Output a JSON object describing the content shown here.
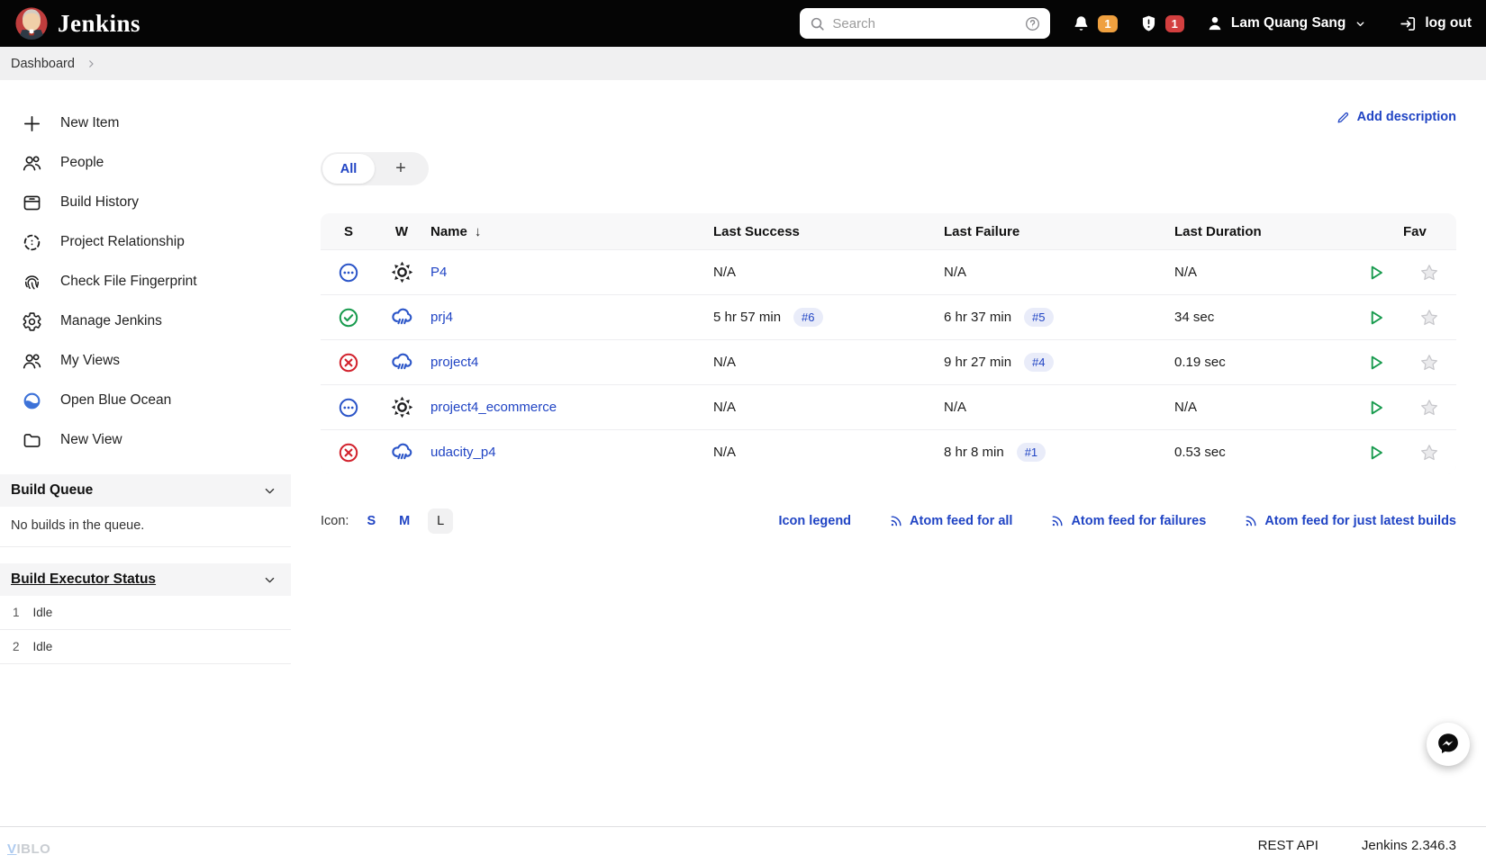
{
  "topbar": {
    "brand": "Jenkins",
    "search_placeholder": "Search",
    "notification_count": "1",
    "security_count": "1",
    "user_name": "Lam Quang Sang",
    "logout_label": "log out"
  },
  "breadcrumb": {
    "items": [
      "Dashboard"
    ]
  },
  "sidebar": {
    "items": [
      {
        "label": "New Item",
        "icon": "plus"
      },
      {
        "label": "People",
        "icon": "people"
      },
      {
        "label": "Build History",
        "icon": "history"
      },
      {
        "label": "Project Relationship",
        "icon": "relationship"
      },
      {
        "label": "Check File Fingerprint",
        "icon": "fingerprint"
      },
      {
        "label": "Manage Jenkins",
        "icon": "gear"
      },
      {
        "label": "My Views",
        "icon": "people"
      },
      {
        "label": "Open Blue Ocean",
        "icon": "blue-ocean"
      },
      {
        "label": "New View",
        "icon": "folder"
      }
    ],
    "build_queue": {
      "title": "Build Queue",
      "empty_text": "No builds in the queue."
    },
    "build_executor_status": {
      "title": "Build Executor Status",
      "executors": [
        {
          "number": "1",
          "status": "Idle"
        },
        {
          "number": "2",
          "status": "Idle"
        }
      ]
    }
  },
  "main": {
    "add_description_label": "Add description",
    "tabs": [
      {
        "label": "All",
        "active": true
      },
      {
        "label": "+"
      }
    ],
    "table": {
      "headers": {
        "s": "S",
        "w": "W",
        "name": "Name",
        "sort_indicator": "↓",
        "last_success": "Last Success",
        "last_failure": "Last Failure",
        "last_duration": "Last Duration",
        "fav": "Fav"
      },
      "rows": [
        {
          "status": "never-built",
          "weather": "sunny",
          "name": "P4",
          "last_success": "N/A",
          "last_failure": "N/A",
          "last_duration": "N/A"
        },
        {
          "status": "success",
          "weather": "raining",
          "name": "prj4",
          "last_success": "5 hr 57 min",
          "success_build": "#6",
          "last_failure": "6 hr 37 min",
          "failure_build": "#5",
          "last_duration": "34 sec"
        },
        {
          "status": "failed",
          "weather": "raining",
          "name": "project4",
          "last_success": "N/A",
          "last_failure": "9 hr 27 min",
          "failure_build": "#4",
          "last_duration": "0.19 sec"
        },
        {
          "status": "never-built",
          "weather": "sunny",
          "name": "project4_ecommerce",
          "last_success": "N/A",
          "last_failure": "N/A",
          "last_duration": "N/A"
        },
        {
          "status": "failed",
          "weather": "raining",
          "name": "udacity_p4",
          "last_success": "N/A",
          "last_failure": "8 hr 8 min",
          "failure_build": "#1",
          "last_duration": "0.53 sec"
        }
      ]
    },
    "icon_size": {
      "label": "Icon:",
      "options": [
        "S",
        "M",
        "L"
      ],
      "selected": "L"
    },
    "links": {
      "icon_legend": "Icon legend",
      "atom_all": "Atom feed for all",
      "atom_failures": "Atom feed for failures",
      "atom_latest": "Atom feed for just latest builds"
    }
  },
  "footer": {
    "rest_api": "REST API",
    "version": "Jenkins 2.346.3",
    "watermark": {
      "first": "V",
      "rest": "IBLO"
    }
  },
  "colors": {
    "topbar_bg": "#050505",
    "accent_blue": "#2044c4",
    "success_green": "#179a4d",
    "error_red": "#d2222d",
    "notification_orange": "#efa03f",
    "security_red": "#d33f3f",
    "badge_pill_bg": "#e9ecf9"
  }
}
